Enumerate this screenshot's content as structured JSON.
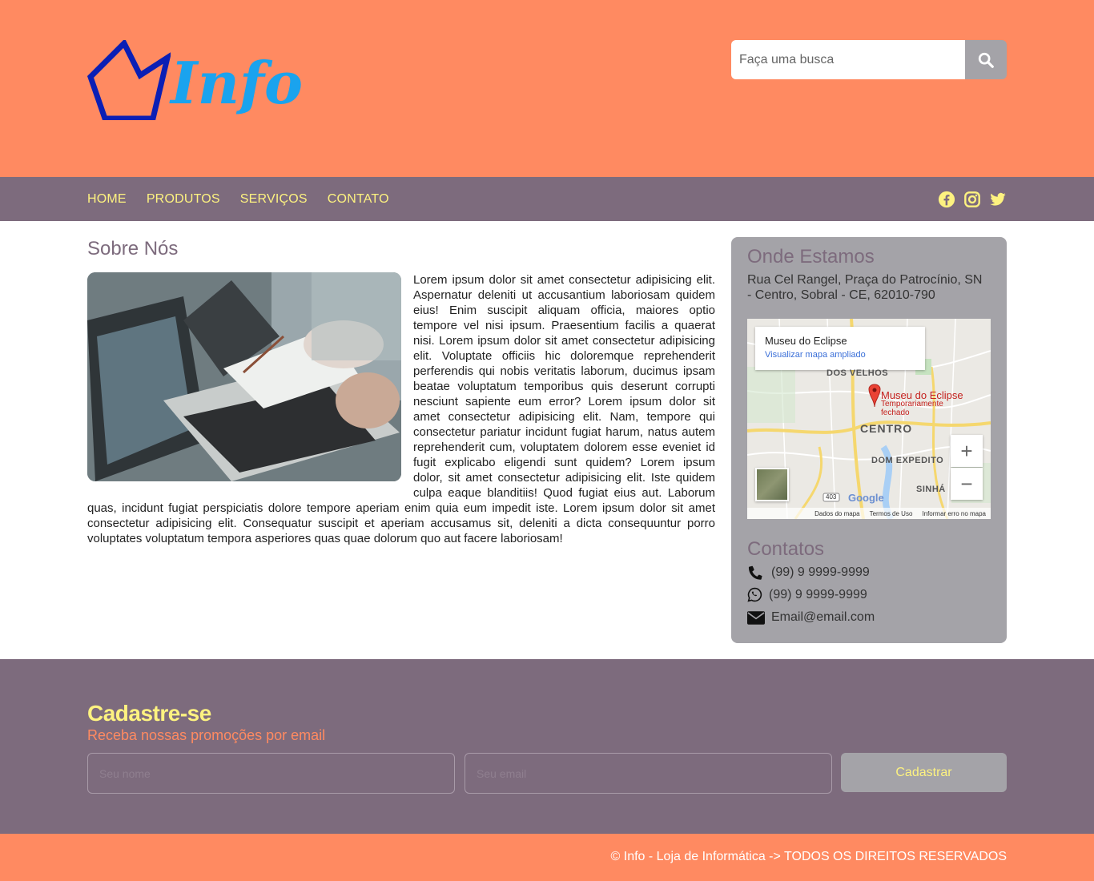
{
  "brand": {
    "name": "Info",
    "logo_icon": "crown-icon",
    "colors": {
      "primary": "#ff8a61",
      "nav": "#7d6b7d",
      "accent": "#fdf280",
      "panel": "#a4a3a8",
      "logo_text": "#1aa3ee",
      "logo_icon": "#0b1fb5"
    }
  },
  "search": {
    "placeholder": "Faça uma busca",
    "icon": "search-icon"
  },
  "nav": {
    "items": [
      {
        "label": "HOME"
      },
      {
        "label": "PRODUTOS"
      },
      {
        "label": "SERVIÇOS"
      },
      {
        "label": "CONTATO"
      }
    ],
    "social": [
      "facebook-icon",
      "instagram-icon",
      "twitter-icon"
    ]
  },
  "about": {
    "title": "Sobre Nós",
    "text": "Lorem ipsum dolor sit amet consectetur adipisicing elit. Aspernatur deleniti ut accusantium laboriosam quidem eius! Enim suscipit aliquam officia, maiores optio tempore vel nisi ipsum. Praesentium facilis a quaerat nisi. Lorem ipsum dolor sit amet consectetur adipisicing elit. Voluptate officiis hic doloremque reprehenderit perferendis qui nobis veritatis laborum, ducimus ipsam beatae voluptatum temporibus quis deserunt corrupti nesciunt sapiente eum error? Lorem ipsum dolor sit amet consectetur adipisicing elit. Nam, tempore qui consectetur pariatur incidunt fugiat harum, natus autem reprehenderit cum, voluptatem dolorem esse eveniet id fugit explicabo eligendi sunt quidem? Lorem ipsum dolor, sit amet consectetur adipisicing elit. Iste quidem culpa eaque blanditiis! Quod fugiat eius aut. Laborum quas, incidunt fugiat perspiciatis dolore tempore aperiam enim quia eum impedit iste. Lorem ipsum dolor sit amet consectetur adipisicing elit. Consequatur suscipit et aperiam accusamus sit, deleniti a dicta consequuntur porro voluptates voluptatum tempora asperiores quas quae dolorum quo aut facere laboriosam!"
  },
  "location": {
    "title": "Onde Estamos",
    "address": "Rua Cel Rangel, Praça do Patrocínio, SN - Centro, Sobral - CE, 62010-790",
    "map": {
      "place_name": "Museu do Eclipse",
      "view_larger": "Visualizar mapa ampliado",
      "marker_label": "Museu do Eclipse",
      "marker_status": "Temporariamente fechado",
      "areas": [
        "DOS VELHOS",
        "CENTRO",
        "DOM EXPEDITO",
        "SINHÁ"
      ],
      "road_label": "403",
      "google_label": "Google",
      "zoom_in": "+",
      "zoom_out": "−",
      "footer": [
        "Dados do mapa",
        "Termos de Uso",
        "Informar erro no mapa"
      ]
    }
  },
  "contacts": {
    "title": "Contatos",
    "phone": "(99) 9 9999-9999",
    "whatsapp": "(99) 9 9999-9999",
    "email": "Email@email.com"
  },
  "newsletter": {
    "title": "Cadastre-se",
    "subtitle": "Receba nossas promoções por email",
    "name_placeholder": "Seu nome",
    "email_placeholder": "Seu email",
    "button": "Cadastrar"
  },
  "footer": {
    "text": "© Info - Loja de Informática -> TODOS OS DIREITOS RESERVADOS"
  }
}
